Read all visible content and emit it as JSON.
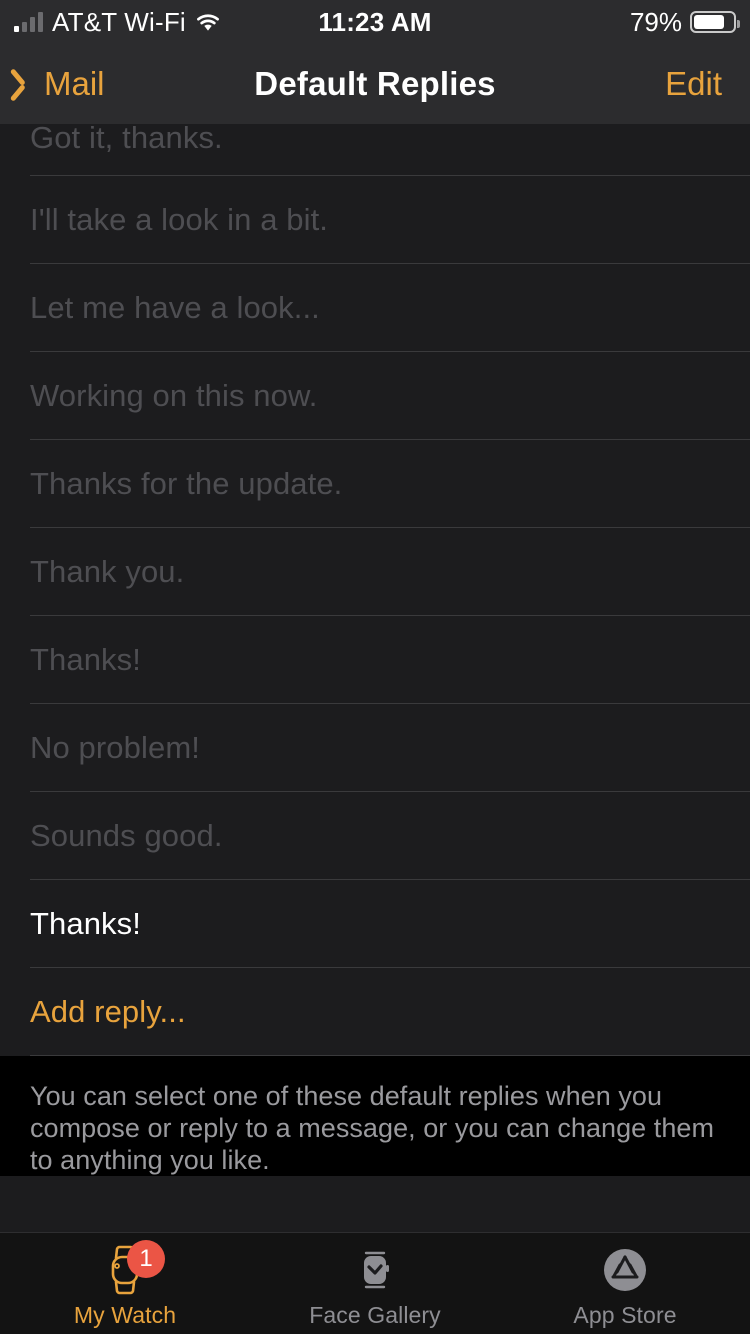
{
  "status_bar": {
    "carrier": "AT&T Wi-Fi",
    "time": "11:23 AM",
    "battery_percent": "79%",
    "battery_level": 79,
    "signal_bars_filled": 1,
    "signal_bars_total": 4,
    "wifi_icon": "wifi-icon",
    "battery_icon": "battery-icon",
    "signal_icon": "cellular-signal-icon"
  },
  "nav_bar": {
    "back_label": "Mail",
    "back_icon": "chevron-left-icon",
    "title": "Default Replies",
    "edit_label": "Edit"
  },
  "list": {
    "rows": [
      {
        "text": "Got it, thanks.",
        "state": "dim"
      },
      {
        "text": "I'll take a look in a bit.",
        "state": "dim"
      },
      {
        "text": "Let me have a look...",
        "state": "dim"
      },
      {
        "text": "Working on this now.",
        "state": "dim"
      },
      {
        "text": "Thanks for the update.",
        "state": "dim"
      },
      {
        "text": "Thank you.",
        "state": "dim"
      },
      {
        "text": "Thanks!",
        "state": "dim"
      },
      {
        "text": "No problem!",
        "state": "dim"
      },
      {
        "text": "Sounds good.",
        "state": "dim"
      },
      {
        "text": "Thanks!",
        "state": "active"
      },
      {
        "text": "Add reply...",
        "state": "add"
      }
    ]
  },
  "footer_note": "You can select one of these default replies when you compose or reply to a message, or you can change them to anything you like.",
  "tab_bar": {
    "tabs": [
      {
        "label": "My Watch",
        "icon": "watch-icon",
        "selected": true,
        "badge": "1"
      },
      {
        "label": "Face Gallery",
        "icon": "watch-face-icon",
        "selected": false,
        "badge": null
      },
      {
        "label": "App Store",
        "icon": "app-store-icon",
        "selected": false,
        "badge": null
      }
    ]
  },
  "colors": {
    "accent": "#E8A33D",
    "badge": "#EB5545",
    "list_background": "#1c1c1e",
    "bar_background": "#2c2c2e",
    "footer_background": "#000000",
    "dim_text": "#4e4e52",
    "inactive_tab": "#8e8e93"
  }
}
